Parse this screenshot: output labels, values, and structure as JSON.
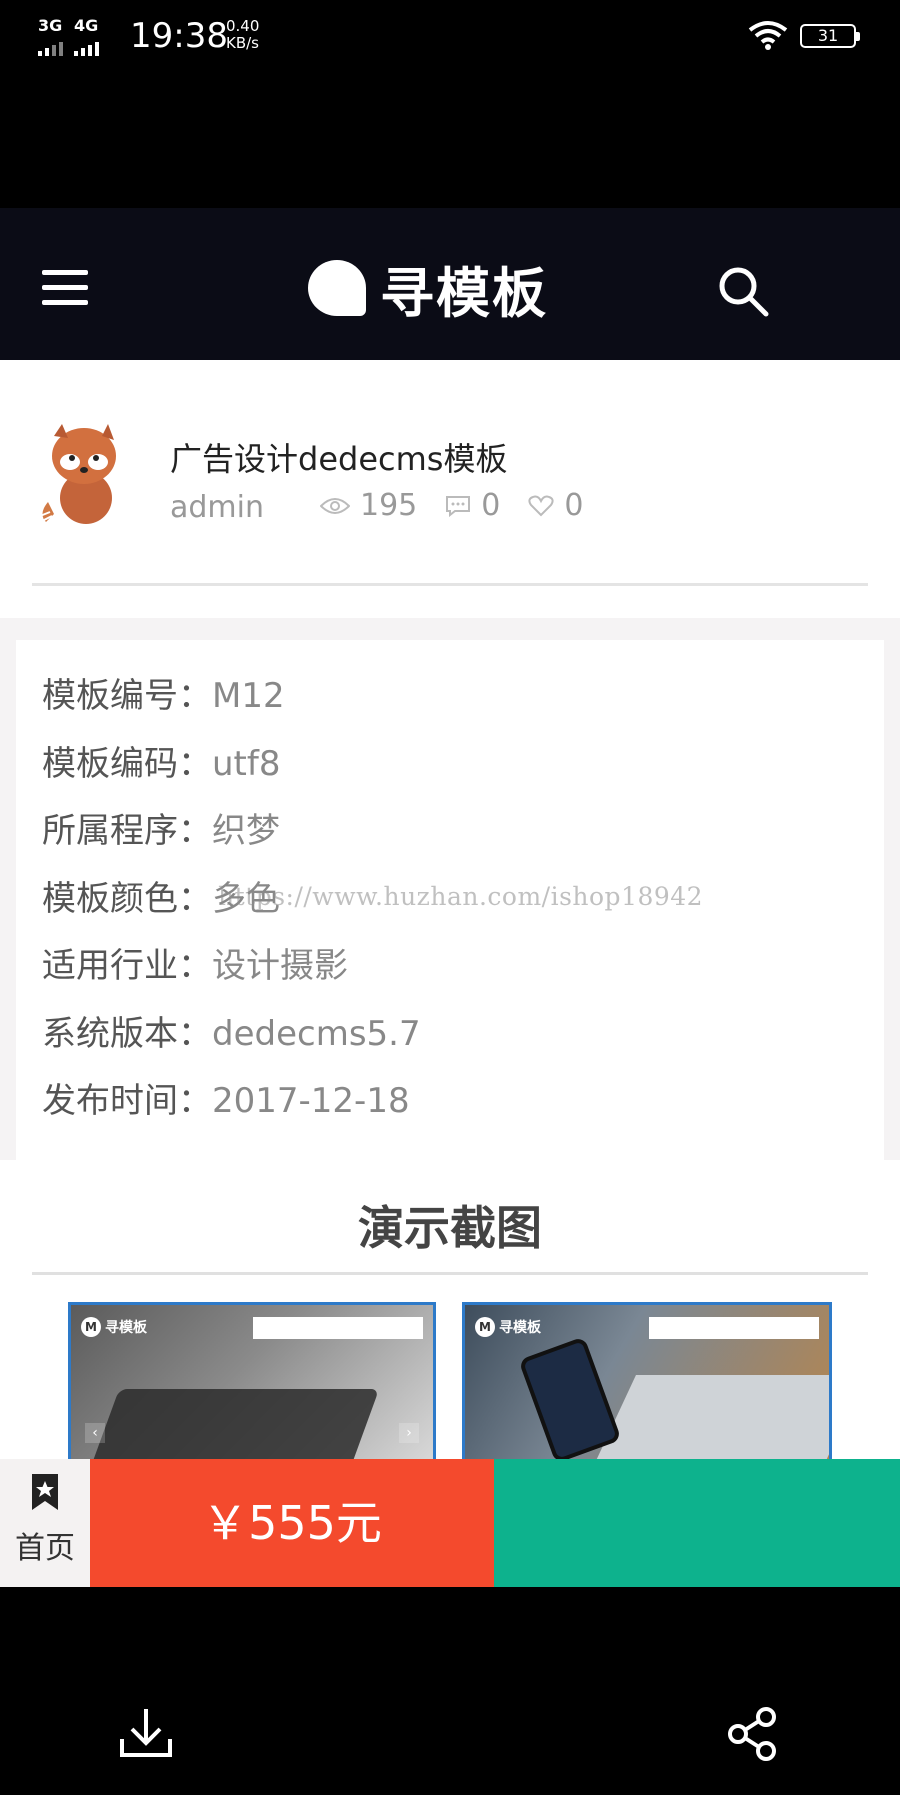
{
  "status_bar": {
    "signal_1": "3G",
    "signal_2": "4G",
    "time": "19:38",
    "net_speed_value": "0.40",
    "net_speed_unit": "KB/s",
    "battery": "31"
  },
  "header": {
    "logo_text": "寻模板",
    "icons": [
      "menu-icon",
      "search-icon"
    ]
  },
  "article": {
    "title": "广告设计dedecms模板",
    "author": "admin",
    "views": "195",
    "comments": "0",
    "likes": "0"
  },
  "info": {
    "rows": [
      {
        "label": "模板编号：",
        "value": "M12"
      },
      {
        "label": "模板编码：",
        "value": "utf8"
      },
      {
        "label": "所属程序：",
        "value": "织梦"
      },
      {
        "label": "模板颜色：",
        "value": "多色"
      },
      {
        "label": "适用行业：",
        "value": "设计摄影"
      },
      {
        "label": "系统版本：",
        "value": "dedecms5.7"
      },
      {
        "label": "发布时间：",
        "value": "2017-12-18"
      }
    ]
  },
  "watermark": "https://www.huzhan.com/ishop18942",
  "demo": {
    "title": "演示截图",
    "shot_logo_text": "寻模板"
  },
  "action_bar": {
    "home_label": "首页",
    "price": "￥555元",
    "colors": {
      "price_bg": "#f44a2d",
      "green_bg": "#0db28d"
    }
  },
  "system_bar": {
    "icons": [
      "download-icon",
      "share-icon"
    ]
  }
}
